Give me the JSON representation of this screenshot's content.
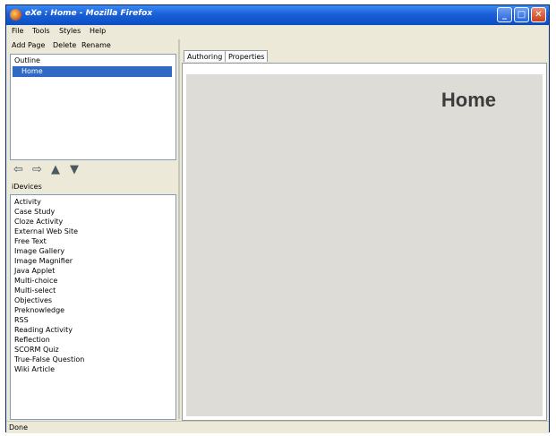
{
  "window": {
    "title": "eXe : Home - Mozilla Firefox"
  },
  "window_buttons": {
    "minimize": "_",
    "maximize": "□",
    "close": "✕"
  },
  "menu": [
    "File",
    "Tools",
    "Styles",
    "Help"
  ],
  "outline_toolbar": {
    "add_page": "Add Page",
    "delete": "Delete",
    "rename": "Rename"
  },
  "outline": {
    "header": "Outline",
    "items": [
      "Home"
    ]
  },
  "outline_arrows": [
    "promote-arrow-icon",
    "demote-arrow-icon",
    "move-up-arrow-icon",
    "move-down-arrow-icon"
  ],
  "outline_arrow_glyphs": [
    "⇦",
    "⇨",
    "▲",
    "▼"
  ],
  "idevices": {
    "header": "iDevices",
    "items": [
      "Activity",
      "Case Study",
      "Cloze Activity",
      "External Web Site",
      "Free Text",
      "Image Gallery",
      "Image Magnifier",
      "Java Applet",
      "Multi-choice",
      "Multi-select",
      "Objectives",
      "Preknowledge",
      "RSS",
      "Reading Activity",
      "Reflection",
      "SCORM Quiz",
      "True-False Question",
      "Wiki Article"
    ]
  },
  "tabs": [
    "Authoring",
    "Properties"
  ],
  "content": {
    "page_title": "Home"
  },
  "status": "Done",
  "colors": {
    "titlebar": "#1a5fd8",
    "selection": "#316ac5",
    "panel": "#ece9d8",
    "content_bg": "#dedcd6"
  }
}
